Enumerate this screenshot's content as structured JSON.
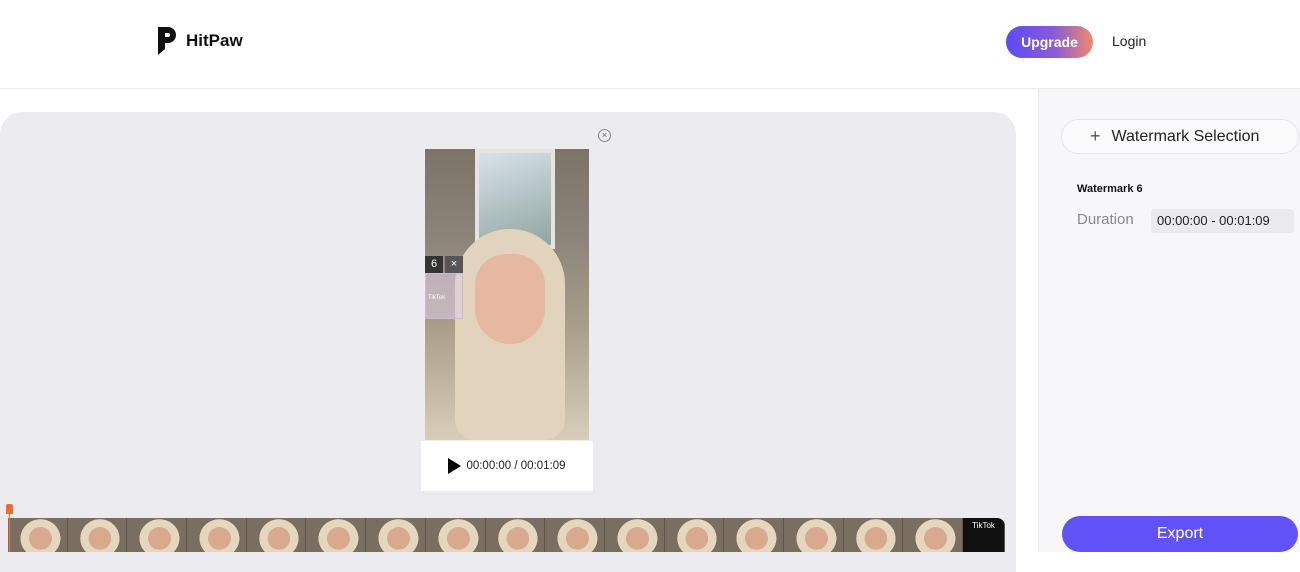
{
  "header": {
    "brand": "HitPaw",
    "upgrade_label": "Upgrade",
    "login_label": "Login"
  },
  "player": {
    "current_time": "00:00:00",
    "separator": " / ",
    "total_time": "00:01:09",
    "time_display": "00:00:00 / 00:01:09"
  },
  "watermark_overlay": {
    "number": "6",
    "close": "×",
    "logo_text": "TikTok"
  },
  "timeline": {
    "frame_count": 16,
    "end_frame_text": "TikTok"
  },
  "sidebar": {
    "selection_label": "Watermark Selection",
    "watermark_title": "Watermark 6",
    "duration_label": "Duration",
    "duration_value": "00:00:00 - 00:01:09",
    "export_label": "Export"
  },
  "colors": {
    "accent": "#6152f5",
    "playhead": "#f26a2e",
    "upgrade_gradient": [
      "#5b4cf5",
      "#ef8a6a"
    ]
  }
}
